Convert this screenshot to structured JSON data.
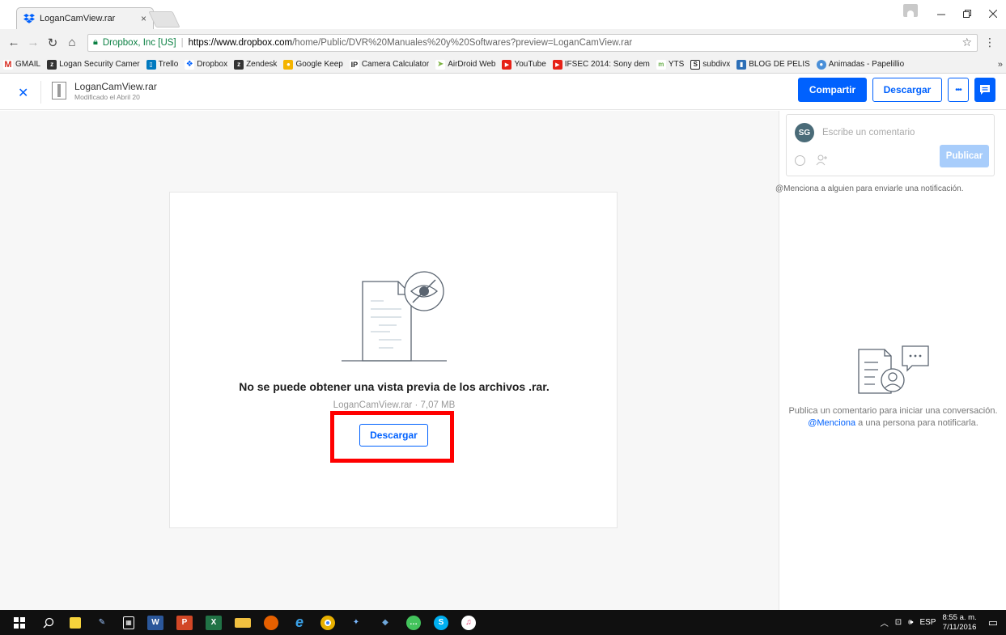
{
  "browser": {
    "tab_title": "LoganCamView.rar",
    "tab_close": "×",
    "secure_label": "Dropbox, Inc [US]",
    "url_host": "https://www.dropbox.com",
    "url_path": "/home/Public/DVR%20Manuales%20y%20Softwares?preview=LoganCamView.rar",
    "bookmarks": [
      {
        "label": "GMAIL",
        "icon": "gmail-icon",
        "color": "#d93025"
      },
      {
        "label": "Logan Security Camer",
        "icon": "zendesk-icon",
        "color": "#333333"
      },
      {
        "label": "Trello",
        "icon": "trello-icon",
        "color": "#0079bf"
      },
      {
        "label": "Dropbox",
        "icon": "dropbox-icon",
        "color": "#0061fe"
      },
      {
        "label": "Zendesk",
        "icon": "zendesk-icon",
        "color": "#333333"
      },
      {
        "label": "Google Keep",
        "icon": "keep-icon",
        "color": "#f4b400"
      },
      {
        "label": "Camera Calculator",
        "icon": "ip-icon",
        "color": "#222222"
      },
      {
        "label": "AirDroid Web",
        "icon": "airdroid-icon",
        "color": "#7cb342"
      },
      {
        "label": "YouTube",
        "icon": "youtube-icon",
        "color": "#e62117"
      },
      {
        "label": "IFSEC 2014: Sony dem",
        "icon": "youtube-icon",
        "color": "#e62117"
      },
      {
        "label": "YTS",
        "icon": "yts-icon",
        "color": "#6ab04c"
      },
      {
        "label": "subdivx",
        "icon": "subdivx-icon",
        "color": "#222222"
      },
      {
        "label": "BLOG DE PELIS",
        "icon": "blog-icon",
        "color": "#2c6fb7"
      },
      {
        "label": "Animadas - Papelillio",
        "icon": "animadas-icon",
        "color": "#4a8fd8"
      }
    ],
    "bookmarks_more": "»"
  },
  "header": {
    "file_name": "LoganCamView.rar",
    "modified": "Modificado el Abril 20",
    "share_label": "Compartir",
    "download_label": "Descargar",
    "more_label": "•••"
  },
  "preview": {
    "message": "No se puede obtener una vista previa de los archivos .rar.",
    "meta": "LoganCamView.rar · 7,07 MB",
    "download_label": "Descargar"
  },
  "comments": {
    "avatar_initials": "SG",
    "input_placeholder": "Escribe un comentario",
    "publish_label": "Publicar",
    "mention_hint": "@Menciona a alguien para enviarle una notificación.",
    "empty_text_1": "Publica un comentario para iniciar una conversación.",
    "empty_link": "@Menciona",
    "empty_text_2": "a una persona para notificarla."
  },
  "taskbar": {
    "language": "ESP",
    "time": "8:55 a. m.",
    "date": "7/11/2016"
  },
  "colors": {
    "accent": "#0061fe",
    "highlight": "#ff0000"
  }
}
